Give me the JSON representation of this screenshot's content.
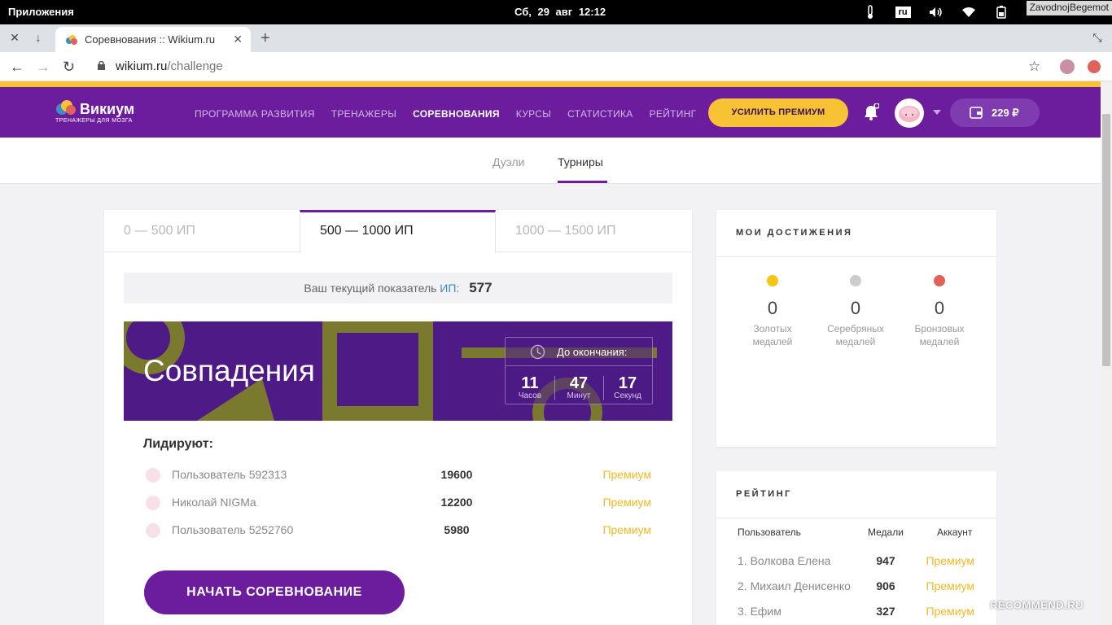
{
  "os": {
    "apps_label": "Приложения",
    "date": "Сб, 29 авг",
    "time": "12:12",
    "lang": "ru",
    "user": "ZavodnojBegemot"
  },
  "browser": {
    "tab_title": "Соревнования :: Wikium.ru",
    "url_host": "wikium.ru",
    "url_path": "/challenge"
  },
  "header": {
    "logo_name": "Викиум",
    "logo_sub": "ТРЕНАЖЕРЫ ДЛЯ МОЗГА",
    "menu": [
      {
        "label": "ПРОГРАММА РАЗВИТИЯ"
      },
      {
        "label": "ТРЕНАЖЕРЫ"
      },
      {
        "label": "СОРЕВНОВАНИЯ"
      },
      {
        "label": "КУРСЫ"
      },
      {
        "label": "СТАТИСТИКА"
      },
      {
        "label": "РЕЙТИНГ"
      }
    ],
    "premium_button": "УСИЛИТЬ ПРЕМИУМ",
    "wallet_amount": "229 ₽"
  },
  "subnav": {
    "duels": "Дуэли",
    "tournaments": "Турниры"
  },
  "ranges": [
    "0 — 500 ИП",
    "500 — 1000 ИП",
    "1000 — 1500 ИП"
  ],
  "ip": {
    "label": "Ваш текущий показатель",
    "abbr": "ИП",
    "colon": ":",
    "value": "577"
  },
  "challenge": {
    "title": "Совпадения",
    "timer_label": "До окончания:",
    "hours": "11",
    "hours_unit": "Часов",
    "minutes": "47",
    "minutes_unit": "Минут",
    "seconds": "17",
    "seconds_unit": "Секунд"
  },
  "leaders": {
    "heading": "Лидируют:",
    "rows": [
      {
        "name": "Пользователь 592313",
        "score": "19600",
        "account": "Премиум"
      },
      {
        "name": "Николай NIGMa",
        "score": "12200",
        "account": "Премиум"
      },
      {
        "name": "Пользователь 5252760",
        "score": "5980",
        "account": "Премиум"
      }
    ]
  },
  "start_button": "НАЧАТЬ СОРЕВНОВАНИЕ",
  "achievements": {
    "heading": "МОИ ДОСТИЖЕНИЯ",
    "medals": [
      {
        "count": "0",
        "line1": "Золотых",
        "line2": "медалей",
        "color": "#f5c518"
      },
      {
        "count": "0",
        "line1": "Серебряных",
        "line2": "медалей",
        "color": "#cccccc"
      },
      {
        "count": "0",
        "line1": "Бронзовых",
        "line2": "медалей",
        "color": "#e0625a"
      }
    ]
  },
  "rating": {
    "heading": "РЕЙТИНГ",
    "col_user": "Пользователь",
    "col_medals": "Медали",
    "col_account": "Аккаунт",
    "rows": [
      {
        "name": "1. Волкова Елена",
        "medals": "947",
        "account": "Премиум"
      },
      {
        "name": "2. Михаил Денисенко",
        "medals": "906",
        "account": "Премиум"
      },
      {
        "name": "3. Ефим",
        "medals": "327",
        "account": "Премиум"
      }
    ]
  },
  "watermark": "RECOMMEND.RU",
  "colors": {
    "brand_purple": "#6b1d9e",
    "accent_yellow": "#f7c233",
    "banner_purple": "#4d1a86",
    "banner_shapes": "#7a7a2e"
  }
}
